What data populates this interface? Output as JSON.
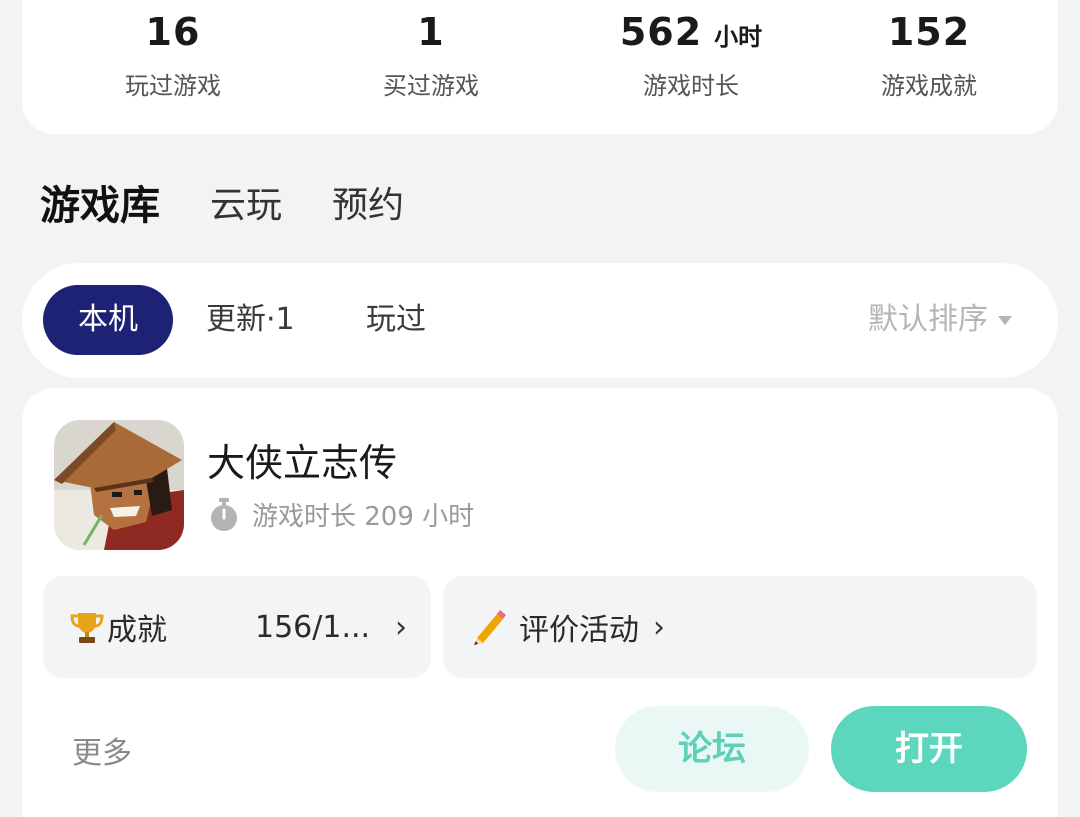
{
  "stats": [
    {
      "value": "16",
      "unit": "",
      "label": "玩过游戏"
    },
    {
      "value": "1",
      "unit": "",
      "label": "买过游戏"
    },
    {
      "value": "562",
      "unit": "小时",
      "label": "游戏时长"
    },
    {
      "value": "152",
      "unit": "",
      "label": "游戏成就"
    }
  ],
  "main_tabs": [
    {
      "label": "游戏库",
      "active": true
    },
    {
      "label": "云玩",
      "active": false
    },
    {
      "label": "预约",
      "active": false
    }
  ],
  "filters": {
    "chips": [
      {
        "label": "本机",
        "active": true
      },
      {
        "label": "更新·1",
        "active": false
      },
      {
        "label": "玩过",
        "active": false
      }
    ],
    "sort_label": "默认排序"
  },
  "game": {
    "title": "大侠立志传",
    "playtime_text": "游戏时长 209 小时",
    "achievement_label": "成就",
    "achievement_value": "156/1...",
    "evaluation_label": "评价活动",
    "more_label": "更多",
    "forum_label": "论坛",
    "open_label": "打开"
  },
  "colors": {
    "accent": "#5dd6be",
    "chip_active_bg": "#1d2275",
    "tab_underline": "#4cd1b4"
  },
  "icons": {
    "stopwatch": "stopwatch-icon",
    "trophy": "trophy-icon",
    "pencil": "pencil-icon",
    "sort_caret": "caret-down-icon"
  }
}
